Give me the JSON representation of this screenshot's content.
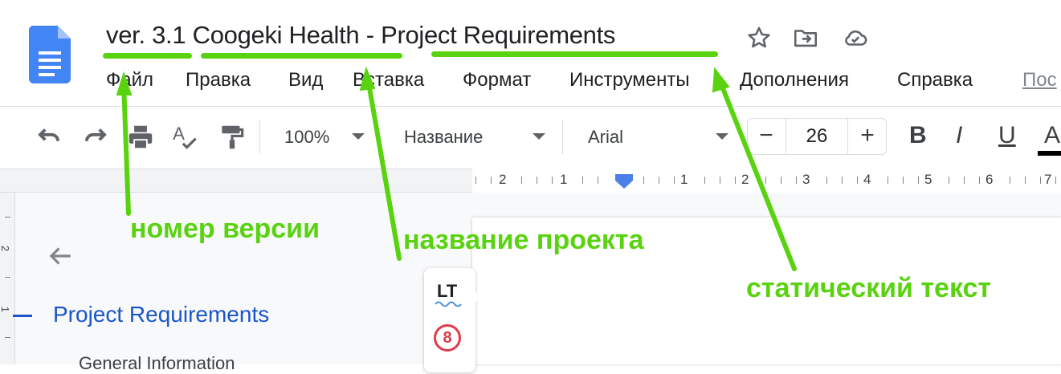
{
  "header": {
    "title_version": "ver. 3.1",
    "title_project": "Coogeki Health",
    "title_separator": "-",
    "title_static": "Project Requirements",
    "icons": [
      "star-icon",
      "move-to-folder-icon",
      "cloud-saved-icon"
    ]
  },
  "menu": {
    "items": [
      "Файл",
      "Правка",
      "Вид",
      "Вставка",
      "Формат",
      "Инструменты",
      "Дополнения",
      "Справка"
    ],
    "last_partial": "Пос"
  },
  "toolbar": {
    "zoom": "100%",
    "style": "Название",
    "font": "Arial",
    "size_minus": "−",
    "size": "26",
    "size_plus": "+",
    "bold": "B",
    "italic": "I",
    "underline": "U",
    "text_color": "A",
    "icons": [
      "undo-icon",
      "redo-icon",
      "print-icon",
      "spellcheck-icon",
      "paint-format-icon"
    ]
  },
  "ruler": {
    "labels": [
      "2",
      "1",
      "1",
      "2",
      "3",
      "4",
      "5",
      "6",
      "7"
    ]
  },
  "vertical_ruler": {
    "labels": [
      "2",
      "1"
    ]
  },
  "outline": {
    "title": "Project Requirements",
    "sub_item": "General Information"
  },
  "languagetool": {
    "logo": "LT",
    "error_count": "8"
  },
  "annotations": {
    "version": "номер версии",
    "project": "название проекта",
    "static": "статический текст"
  },
  "colors": {
    "annotation": "#59d30f",
    "outline_title": "#1a56c8",
    "docs_blue": "#4285f4",
    "error_red": "#e03b4b"
  }
}
